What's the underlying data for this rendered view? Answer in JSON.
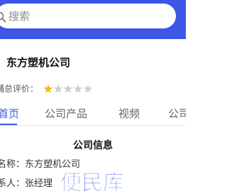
{
  "search": {
    "placeholder": "搜索"
  },
  "company": {
    "name": "东方塑机公司",
    "rating_label": "铺总评价：",
    "rating_value": 1,
    "rating_max": 5
  },
  "tabs": [
    {
      "label": "首页",
      "active": true
    },
    {
      "label": "公司产品",
      "active": false
    },
    {
      "label": "视频",
      "active": false
    },
    {
      "label": "公司",
      "active": false
    }
  ],
  "info": {
    "title": "公司信息",
    "name_line": "名称：东方塑机公司",
    "contact_line": "系人：张经理"
  },
  "watermark": {
    "text": "便民库"
  },
  "colors": {
    "primary": "#3D56E8",
    "star_active": "#F5B70A",
    "star_inactive": "#D0D0D0"
  }
}
